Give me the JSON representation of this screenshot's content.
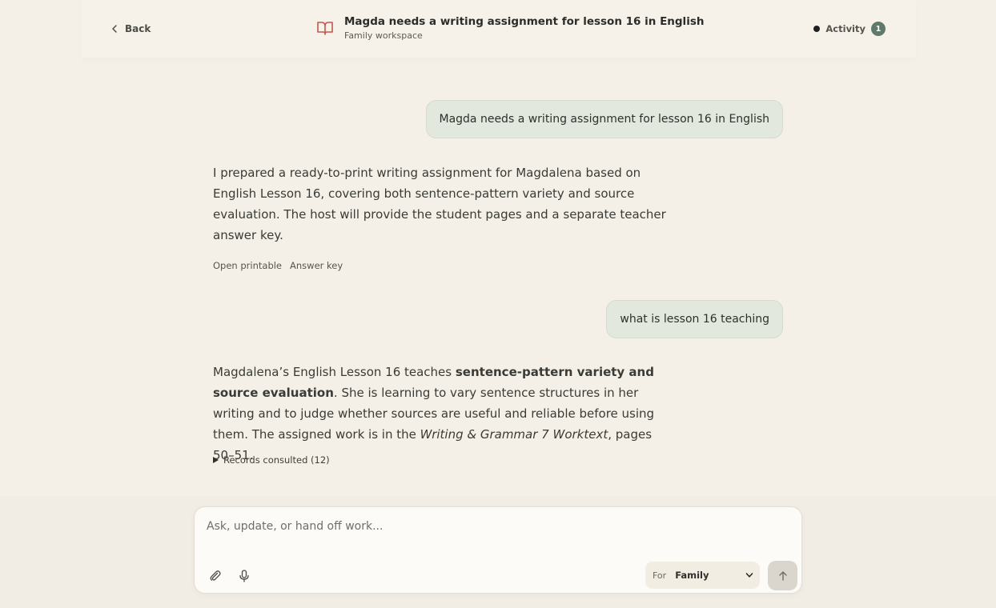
{
  "header": {
    "back_label": "Back",
    "title": "Magda needs a writing assignment for lesson 16 in English",
    "subtitle": "Family workspace",
    "activity_label": "Activity",
    "activity_count": "1"
  },
  "conversation": {
    "user_1": "Magda needs a writing assignment for lesson 16 in English",
    "assistant_1": "I prepared a ready-to-print writing assignment for Magdalena based on English Lesson 16, covering both sentence-pattern variety and source evaluation. The host will provide the student pages and a separate teacher answer key.",
    "actions": [
      "Open printable",
      "Answer key"
    ],
    "user_2": "what is lesson 16 teaching",
    "assistant_2": {
      "intro": "Magdalena’s English Lesson 16 teaches ",
      "bold": "sentence-pattern variety and source evaluation",
      "middle": ". She is learning to vary sentence structures in her writing and to judge whether sources are useful and reliable before using them. The assigned work is in the ",
      "italic": "Writing & Grammar 7 Worktext",
      "end": ", pages 50–51."
    },
    "records_label": "Records consulted (12)"
  },
  "composer": {
    "placeholder": "Ask, update, or hand off work...",
    "for_label": "For",
    "for_value": "Family"
  },
  "icons": {
    "back": "chevron-left-icon",
    "book": "open-book-icon",
    "attach": "paperclip-icon",
    "mic": "microphone-icon",
    "send": "arrow-up-icon",
    "select": "chevron-down-icon"
  },
  "colors": {
    "background": "#f4f0e7",
    "user_bubble": "#e2e8dd",
    "book_icon": "#c0574e",
    "activity_badge": "#5f7a6b"
  }
}
